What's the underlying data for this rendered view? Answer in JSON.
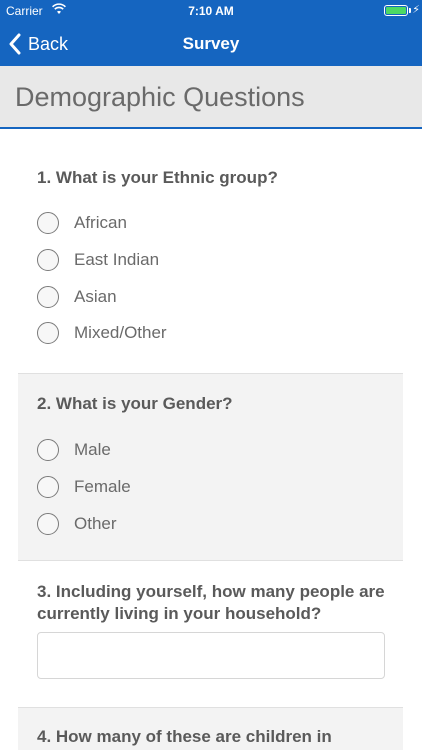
{
  "status_bar": {
    "carrier": "Carrier",
    "time": "7:10 AM",
    "battery_level": 1.0,
    "wifi_icon": "wifi-icon",
    "charging_icon": "bolt-icon"
  },
  "nav": {
    "back_label": "Back",
    "title": "Survey",
    "color": "#1565c0"
  },
  "section": {
    "title": "Demographic Questions"
  },
  "questions": [
    {
      "text": "1. What is your Ethnic group?",
      "options": [
        "African",
        "East Indian",
        "Asian",
        "Mixed/Other"
      ]
    },
    {
      "text": "2. What is your Gender?",
      "options": [
        "Male",
        "Female",
        "Other"
      ]
    },
    {
      "text": "3. Including yourself, how many people are currently living in your household?",
      "input_value": "",
      "placeholder": ""
    },
    {
      "text": "4. How many of these are children in"
    }
  ]
}
